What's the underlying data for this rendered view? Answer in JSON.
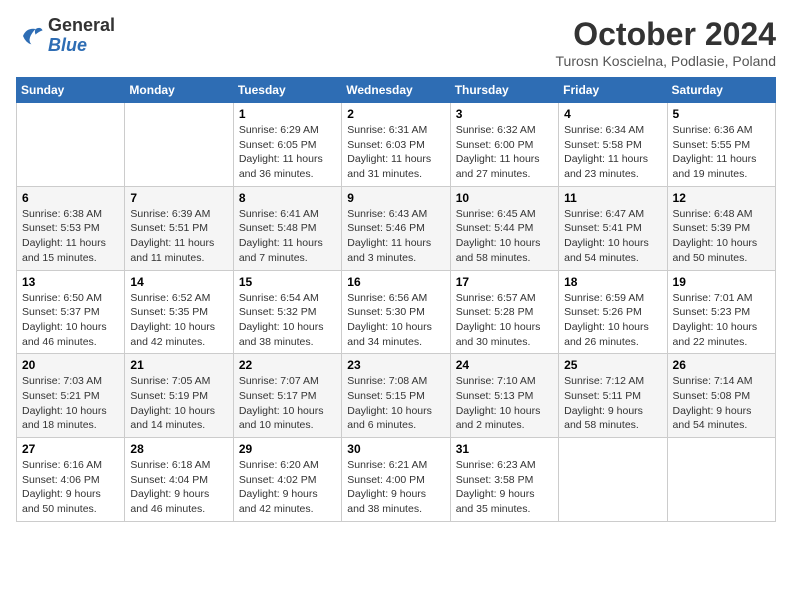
{
  "header": {
    "logo_line1": "General",
    "logo_line2": "Blue",
    "month": "October 2024",
    "location": "Turosn Koscielna, Podlasie, Poland"
  },
  "weekdays": [
    "Sunday",
    "Monday",
    "Tuesday",
    "Wednesday",
    "Thursday",
    "Friday",
    "Saturday"
  ],
  "weeks": [
    [
      {
        "day": "",
        "info": ""
      },
      {
        "day": "",
        "info": ""
      },
      {
        "day": "1",
        "info": "Sunrise: 6:29 AM\nSunset: 6:05 PM\nDaylight: 11 hours and 36 minutes."
      },
      {
        "day": "2",
        "info": "Sunrise: 6:31 AM\nSunset: 6:03 PM\nDaylight: 11 hours and 31 minutes."
      },
      {
        "day": "3",
        "info": "Sunrise: 6:32 AM\nSunset: 6:00 PM\nDaylight: 11 hours and 27 minutes."
      },
      {
        "day": "4",
        "info": "Sunrise: 6:34 AM\nSunset: 5:58 PM\nDaylight: 11 hours and 23 minutes."
      },
      {
        "day": "5",
        "info": "Sunrise: 6:36 AM\nSunset: 5:55 PM\nDaylight: 11 hours and 19 minutes."
      }
    ],
    [
      {
        "day": "6",
        "info": "Sunrise: 6:38 AM\nSunset: 5:53 PM\nDaylight: 11 hours and 15 minutes."
      },
      {
        "day": "7",
        "info": "Sunrise: 6:39 AM\nSunset: 5:51 PM\nDaylight: 11 hours and 11 minutes."
      },
      {
        "day": "8",
        "info": "Sunrise: 6:41 AM\nSunset: 5:48 PM\nDaylight: 11 hours and 7 minutes."
      },
      {
        "day": "9",
        "info": "Sunrise: 6:43 AM\nSunset: 5:46 PM\nDaylight: 11 hours and 3 minutes."
      },
      {
        "day": "10",
        "info": "Sunrise: 6:45 AM\nSunset: 5:44 PM\nDaylight: 10 hours and 58 minutes."
      },
      {
        "day": "11",
        "info": "Sunrise: 6:47 AM\nSunset: 5:41 PM\nDaylight: 10 hours and 54 minutes."
      },
      {
        "day": "12",
        "info": "Sunrise: 6:48 AM\nSunset: 5:39 PM\nDaylight: 10 hours and 50 minutes."
      }
    ],
    [
      {
        "day": "13",
        "info": "Sunrise: 6:50 AM\nSunset: 5:37 PM\nDaylight: 10 hours and 46 minutes."
      },
      {
        "day": "14",
        "info": "Sunrise: 6:52 AM\nSunset: 5:35 PM\nDaylight: 10 hours and 42 minutes."
      },
      {
        "day": "15",
        "info": "Sunrise: 6:54 AM\nSunset: 5:32 PM\nDaylight: 10 hours and 38 minutes."
      },
      {
        "day": "16",
        "info": "Sunrise: 6:56 AM\nSunset: 5:30 PM\nDaylight: 10 hours and 34 minutes."
      },
      {
        "day": "17",
        "info": "Sunrise: 6:57 AM\nSunset: 5:28 PM\nDaylight: 10 hours and 30 minutes."
      },
      {
        "day": "18",
        "info": "Sunrise: 6:59 AM\nSunset: 5:26 PM\nDaylight: 10 hours and 26 minutes."
      },
      {
        "day": "19",
        "info": "Sunrise: 7:01 AM\nSunset: 5:23 PM\nDaylight: 10 hours and 22 minutes."
      }
    ],
    [
      {
        "day": "20",
        "info": "Sunrise: 7:03 AM\nSunset: 5:21 PM\nDaylight: 10 hours and 18 minutes."
      },
      {
        "day": "21",
        "info": "Sunrise: 7:05 AM\nSunset: 5:19 PM\nDaylight: 10 hours and 14 minutes."
      },
      {
        "day": "22",
        "info": "Sunrise: 7:07 AM\nSunset: 5:17 PM\nDaylight: 10 hours and 10 minutes."
      },
      {
        "day": "23",
        "info": "Sunrise: 7:08 AM\nSunset: 5:15 PM\nDaylight: 10 hours and 6 minutes."
      },
      {
        "day": "24",
        "info": "Sunrise: 7:10 AM\nSunset: 5:13 PM\nDaylight: 10 hours and 2 minutes."
      },
      {
        "day": "25",
        "info": "Sunrise: 7:12 AM\nSunset: 5:11 PM\nDaylight: 9 hours and 58 minutes."
      },
      {
        "day": "26",
        "info": "Sunrise: 7:14 AM\nSunset: 5:08 PM\nDaylight: 9 hours and 54 minutes."
      }
    ],
    [
      {
        "day": "27",
        "info": "Sunrise: 6:16 AM\nSunset: 4:06 PM\nDaylight: 9 hours and 50 minutes."
      },
      {
        "day": "28",
        "info": "Sunrise: 6:18 AM\nSunset: 4:04 PM\nDaylight: 9 hours and 46 minutes."
      },
      {
        "day": "29",
        "info": "Sunrise: 6:20 AM\nSunset: 4:02 PM\nDaylight: 9 hours and 42 minutes."
      },
      {
        "day": "30",
        "info": "Sunrise: 6:21 AM\nSunset: 4:00 PM\nDaylight: 9 hours and 38 minutes."
      },
      {
        "day": "31",
        "info": "Sunrise: 6:23 AM\nSunset: 3:58 PM\nDaylight: 9 hours and 35 minutes."
      },
      {
        "day": "",
        "info": ""
      },
      {
        "day": "",
        "info": ""
      }
    ]
  ]
}
